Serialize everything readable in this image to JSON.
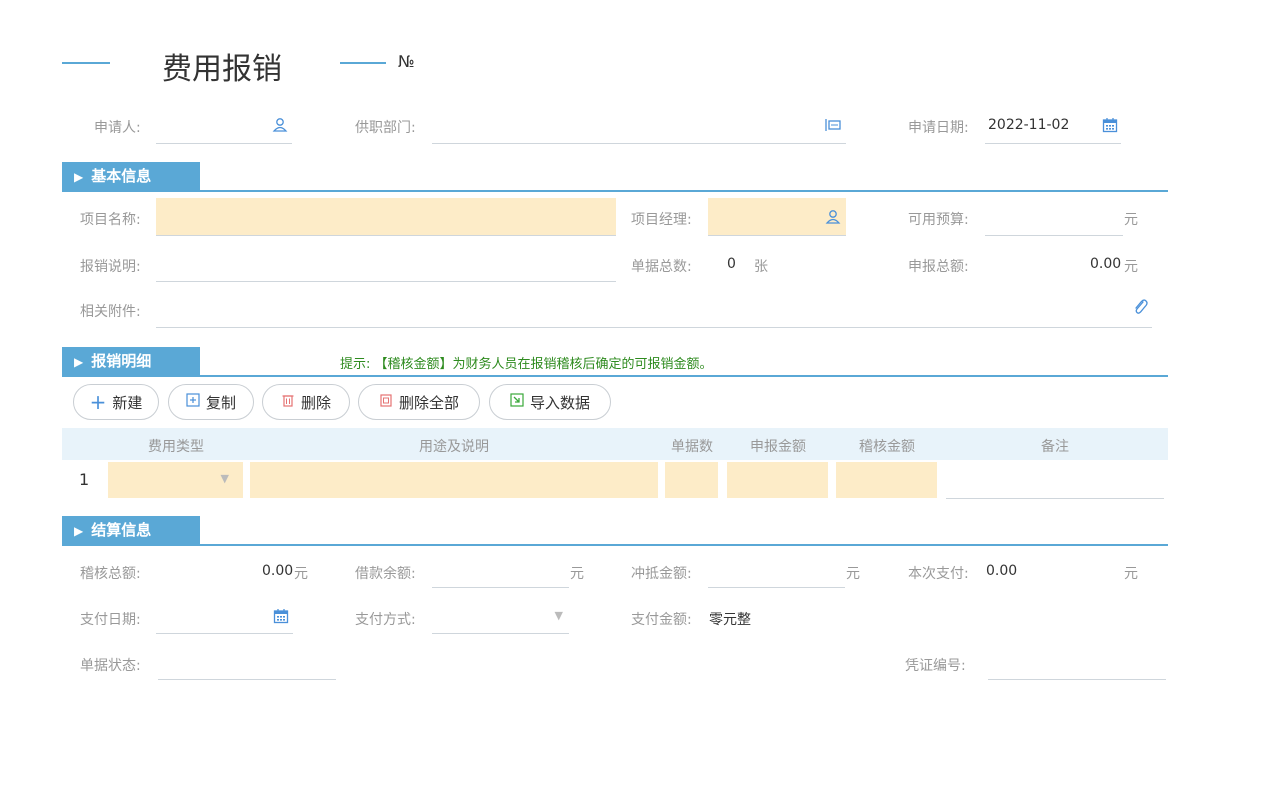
{
  "header": {
    "title": "费用报销",
    "no_label": "№"
  },
  "applicant": {
    "label": "申请人:",
    "value": ""
  },
  "department": {
    "label": "供职部门:",
    "value": ""
  },
  "apply_date": {
    "label": "申请日期:",
    "value": "2022-11-02"
  },
  "sections": {
    "basic": "基本信息",
    "detail": "报销明细",
    "settle": "结算信息"
  },
  "basic": {
    "project_name": {
      "label": "项目名称:",
      "value": ""
    },
    "project_manager": {
      "label": "项目经理:",
      "value": ""
    },
    "available_budget": {
      "label": "可用预算:",
      "value": "",
      "unit": "元"
    },
    "description": {
      "label": "报销说明:",
      "value": ""
    },
    "doc_count": {
      "label": "单据总数:",
      "value": "0",
      "unit": "张"
    },
    "total_claim": {
      "label": "申报总额:",
      "value": "0.00",
      "unit": "元"
    },
    "attachments": {
      "label": "相关附件:",
      "value": ""
    }
  },
  "hint": "提示: 【稽核金额】为财务人员在报销稽核后确定的可报销金额。",
  "toolbar": {
    "new": "新建",
    "copy": "复制",
    "delete": "删除",
    "delete_all": "删除全部",
    "import": "导入数据"
  },
  "table": {
    "headers": [
      "费用类型",
      "用途及说明",
      "单据数",
      "申报金额",
      "稽核金额",
      "备注"
    ],
    "rows": [
      {
        "index": "1",
        "type": "",
        "purpose": "",
        "count": "",
        "claim": "",
        "audit": "",
        "note": ""
      }
    ]
  },
  "settle": {
    "audit_total": {
      "label": "稽核总额:",
      "value": "0.00",
      "unit": "元"
    },
    "loan_balance": {
      "label": "借款余额:",
      "value": "",
      "unit": "元"
    },
    "offset_amount": {
      "label": "冲抵金额:",
      "value": "",
      "unit": "元"
    },
    "this_payment": {
      "label": "本次支付:",
      "value": "0.00",
      "unit": "元"
    },
    "pay_date": {
      "label": "支付日期:",
      "value": ""
    },
    "pay_method": {
      "label": "支付方式:",
      "value": ""
    },
    "pay_amount": {
      "label": "支付金额:",
      "value": "零元整"
    },
    "doc_status": {
      "label": "单据状态:",
      "value": ""
    },
    "voucher_no": {
      "label": "凭证编号:",
      "value": ""
    }
  },
  "icons": {
    "user": "user-icon",
    "dept": "department-icon",
    "calendar": "calendar-icon",
    "attach": "paperclip-icon",
    "dropdown": "dropdown-icon"
  },
  "colors": {
    "accent": "#5aa8d6",
    "highlight": "#fdecc8",
    "hint": "#2e8b1f",
    "table_header": "#e8f3fa"
  }
}
